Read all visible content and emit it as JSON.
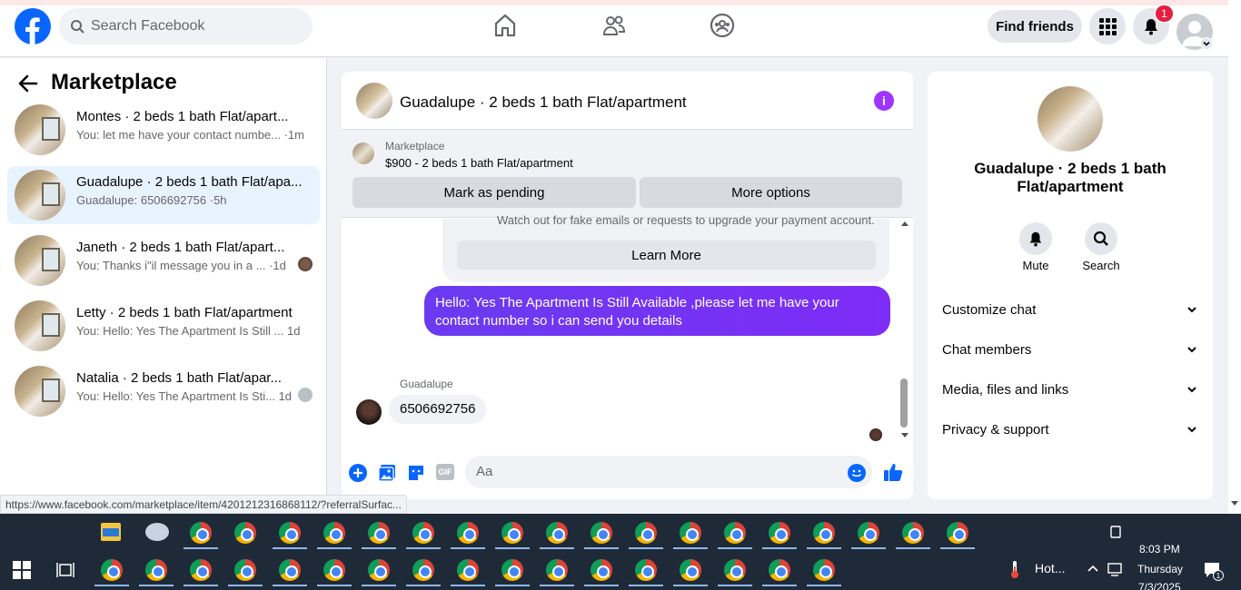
{
  "header": {
    "search_placeholder": "Search Facebook",
    "find_friends": "Find friends",
    "notif_count": "1",
    "nav_icons": [
      "home-icon",
      "friends-icon",
      "groups-icon"
    ]
  },
  "sidebar": {
    "title": "Marketplace",
    "conversations": [
      {
        "name": "Montes · 2 beds 1 bath Flat/apart...",
        "preview": "You: let me have your contact numbe... ·1m"
      },
      {
        "name": "Guadalupe · 2 beds 1 bath Flat/apa...",
        "preview": "Guadalupe: 6506692756 ·5h"
      },
      {
        "name": "Janeth · 2 beds 1 bath Flat/apart...",
        "preview": "You: Thanks i\"il message you in a ...   ·1d"
      },
      {
        "name": "Letty · 2 beds 1 bath Flat/apartment",
        "preview": "You: Hello: Yes The Apartment Is Still ...   1d"
      },
      {
        "name": "Natalia · 2 beds 1 bath Flat/apar...",
        "preview": "You: Hello: Yes The Apartment Is Sti...   1d"
      }
    ]
  },
  "chat": {
    "title": "Guadalupe · 2 beds 1 bath Flat/apartment",
    "marketplace_label": "Marketplace",
    "listing": "$900 - 2 beds 1 bath Flat/apartment",
    "mark_pending": "Mark as pending",
    "more_options": "More options",
    "warning_text": "Watch out for fake emails or requests to upgrade your payment account.",
    "learn_more": "Learn More",
    "outgoing_message": "Hello: Yes The Apartment Is Still Available ,please let me have your contact number so i can send you details",
    "sender_name": "Guadalupe",
    "incoming_message": "6506692756",
    "composer_placeholder": "Aa"
  },
  "details": {
    "name": "Guadalupe · 2 beds 1 bath Flat/apartment",
    "mute": "Mute",
    "search": "Search",
    "sections": [
      "Customize chat",
      "Chat members",
      "Media, files and links",
      "Privacy & support"
    ]
  },
  "status_url": "https://www.facebook.com/marketplace/item/4201212316868112/?referralSurfac...",
  "taskbar": {
    "weather": "Hot...",
    "time": "8:03 PM",
    "day": "Thursday",
    "date": "7/3/2025",
    "action_count": "1"
  },
  "colors": {
    "brand": "#0866ff",
    "message_purple": "#7431f9",
    "info_purple": "#a033ff",
    "badge": "#e41e3f"
  }
}
